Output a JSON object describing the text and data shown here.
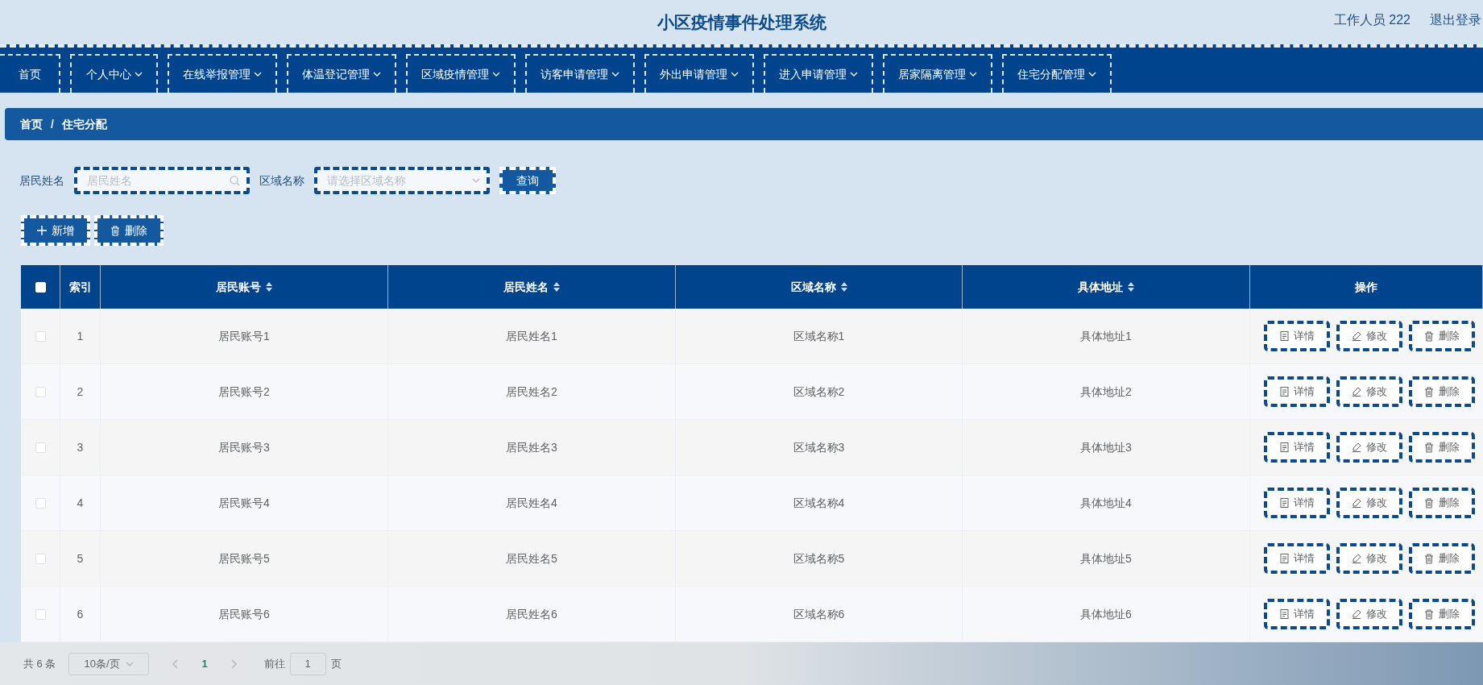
{
  "header": {
    "title": "小区疫情事件处理系统",
    "user": "工作人员 222",
    "logout": "退出登录"
  },
  "nav": [
    {
      "label": "首页",
      "dropdown": false
    },
    {
      "label": "个人中心",
      "dropdown": true
    },
    {
      "label": "在线举报管理",
      "dropdown": true
    },
    {
      "label": "体温登记管理",
      "dropdown": true
    },
    {
      "label": "区域疫情管理",
      "dropdown": true
    },
    {
      "label": "访客申请管理",
      "dropdown": true
    },
    {
      "label": "外出申请管理",
      "dropdown": true
    },
    {
      "label": "进入申请管理",
      "dropdown": true
    },
    {
      "label": "居家隔离管理",
      "dropdown": true
    },
    {
      "label": "住宅分配管理",
      "dropdown": true
    }
  ],
  "breadcrumb": {
    "items": [
      "首页",
      "住宅分配"
    ],
    "separator": "/"
  },
  "filters": [
    {
      "label": "居民姓名",
      "kind": "search",
      "placeholder": "居民姓名"
    },
    {
      "label": "区域名称",
      "kind": "select",
      "placeholder": "请选择区域名称"
    }
  ],
  "query_button": "查询",
  "actions": [
    {
      "label": "新增",
      "kind": "add"
    },
    {
      "label": "删除",
      "kind": "delete"
    }
  ],
  "table": {
    "select_all": {
      "checked": false
    },
    "columns": [
      {
        "label": "索引",
        "sortable": false
      },
      {
        "label": "居民账号",
        "sortable": true
      },
      {
        "label": "居民姓名",
        "sortable": true
      },
      {
        "label": "区域名称",
        "sortable": true
      },
      {
        "label": "具体地址",
        "sortable": true
      },
      {
        "label": "操作",
        "sortable": false
      }
    ],
    "rows": [
      {
        "checked": false,
        "cells": [
          "1",
          "居民账号1",
          "居民姓名1",
          "区域名称1",
          "具体地址1"
        ],
        "actions": [
          {
            "kind": "detail",
            "label": "详情"
          },
          {
            "kind": "edit",
            "label": "修改"
          },
          {
            "kind": "delete",
            "label": "删除"
          }
        ]
      },
      {
        "checked": false,
        "cells": [
          "2",
          "居民账号2",
          "居民姓名2",
          "区域名称2",
          "具体地址2"
        ],
        "actions": [
          {
            "kind": "detail",
            "label": "详情"
          },
          {
            "kind": "edit",
            "label": "修改"
          },
          {
            "kind": "delete",
            "label": "删除"
          }
        ]
      },
      {
        "checked": false,
        "cells": [
          "3",
          "居民账号3",
          "居民姓名3",
          "区域名称3",
          "具体地址3"
        ],
        "actions": [
          {
            "kind": "detail",
            "label": "详情"
          },
          {
            "kind": "edit",
            "label": "修改"
          },
          {
            "kind": "delete",
            "label": "删除"
          }
        ]
      },
      {
        "checked": false,
        "cells": [
          "4",
          "居民账号4",
          "居民姓名4",
          "区域名称4",
          "具体地址4"
        ],
        "actions": [
          {
            "kind": "detail",
            "label": "详情"
          },
          {
            "kind": "edit",
            "label": "修改"
          },
          {
            "kind": "delete",
            "label": "删除"
          }
        ]
      },
      {
        "checked": false,
        "cells": [
          "5",
          "居民账号5",
          "居民姓名5",
          "区域名称5",
          "具体地址5"
        ],
        "actions": [
          {
            "kind": "detail",
            "label": "详情"
          },
          {
            "kind": "edit",
            "label": "修改"
          },
          {
            "kind": "delete",
            "label": "删除"
          }
        ]
      },
      {
        "checked": false,
        "cells": [
          "6",
          "居民账号6",
          "居民姓名6",
          "区域名称6",
          "具体地址6"
        ],
        "actions": [
          {
            "kind": "detail",
            "label": "详情"
          },
          {
            "kind": "edit",
            "label": "修改"
          },
          {
            "kind": "delete",
            "label": "删除"
          }
        ]
      }
    ]
  },
  "pagination": {
    "total": "共 6 条",
    "page_size": "10条/页",
    "pages": [
      {
        "label": "1",
        "selected": true
      }
    ],
    "goto_label": "前往",
    "goto_value": "1",
    "goto_suffix": "页"
  }
}
